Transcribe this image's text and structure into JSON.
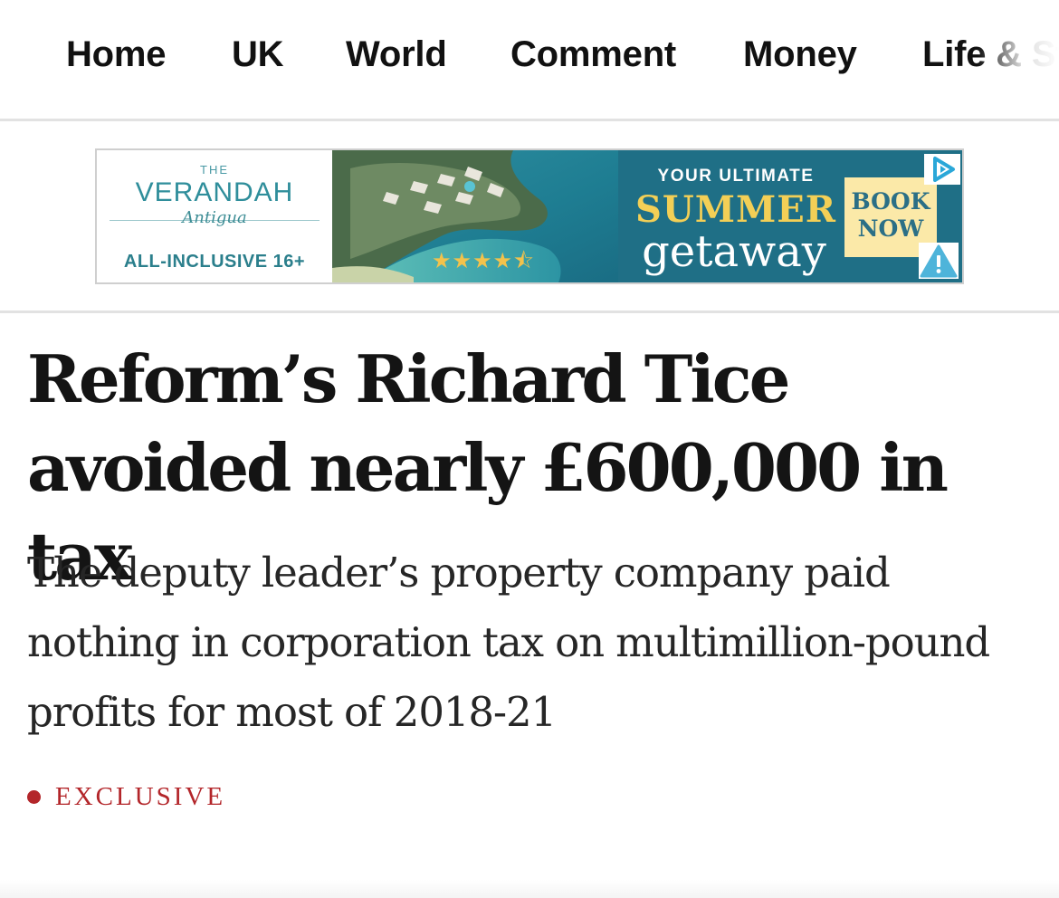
{
  "nav": {
    "items": [
      {
        "label": "Home"
      },
      {
        "label": "UK"
      },
      {
        "label": "World"
      },
      {
        "label": "Comment"
      },
      {
        "label": "Money"
      },
      {
        "label": "Life & St"
      }
    ]
  },
  "ad": {
    "brand_the": "THE",
    "brand_name": "VERANDAH",
    "brand_sub": "Antigua",
    "brand_tag": "ALL-INCLUSIVE 16+",
    "stars": "★★★★⯪",
    "promo_line1": "YOUR ULTIMATE",
    "promo_line2": "SUMMER",
    "promo_line3": "getaway",
    "cta_line1": "BOOK",
    "cta_line2": "NOW",
    "choices_icon": "ad-choices-icon",
    "warning_icon": "warning-icon"
  },
  "article": {
    "headline": "Reform’s Richard Tice avoided nearly £600,000 in tax",
    "standfirst": "The deputy leader’s property company paid nothing in corporation tax on multimillion-pound profits for most of 2018-21",
    "tag": "EXCLUSIVE"
  },
  "colors": {
    "accent_red": "#b3262a",
    "ad_teal": "#1f6f86",
    "ad_gold": "#f3cf56"
  }
}
